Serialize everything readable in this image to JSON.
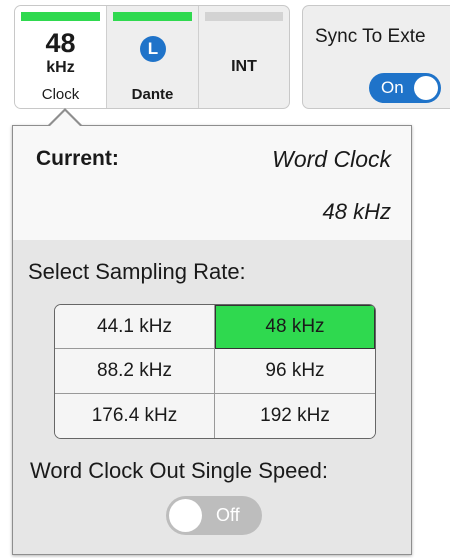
{
  "clock_sources": {
    "clock": {
      "rate": "48",
      "unit": "kHz",
      "label": "Clock",
      "status": "active"
    },
    "dante": {
      "badge": "L",
      "label": "Dante",
      "status": "active"
    },
    "int": {
      "label": "INT",
      "status": "inactive"
    }
  },
  "sync": {
    "label": "Sync To Exte",
    "toggle": "On"
  },
  "popover": {
    "current_label": "Current:",
    "current_source": "Word Clock",
    "current_rate": "48 kHz",
    "select_label": "Select Sampling Rate:",
    "rates": [
      "44.1 kHz",
      "48 kHz",
      "88.2 kHz",
      "96 kHz",
      "176.4 kHz",
      "192 kHz"
    ],
    "selected_rate": "48 kHz",
    "word_clock_label": "Word Clock Out Single Speed:",
    "word_clock_toggle": "Off"
  },
  "colors": {
    "active_green": "#2fd94f",
    "inactive_grey": "#d3d3d3",
    "accent_blue": "#1f73c9"
  }
}
